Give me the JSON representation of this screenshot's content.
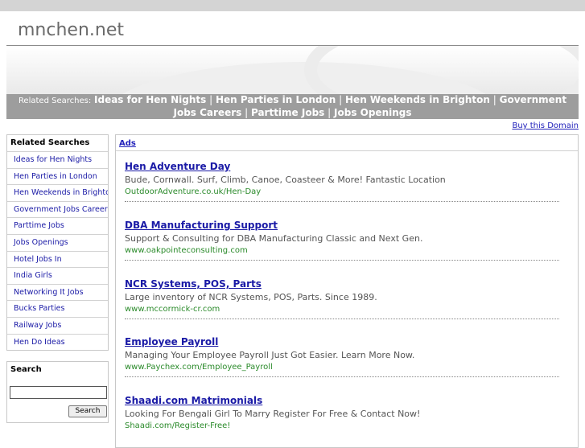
{
  "header": {
    "domain": "mnchen.net"
  },
  "related_bar": {
    "label": "Related Searches:",
    "links": [
      "Ideas for Hen Nights",
      "Hen Parties in London",
      "Hen Weekends in Brighton",
      "Government Jobs Careers",
      "Parttime Jobs",
      "Jobs Openings"
    ],
    "separator": "|"
  },
  "buy_link": "Buy this Domain",
  "sidebar": {
    "title": "Related Searches",
    "items": [
      "Ideas for Hen Nights",
      "Hen Parties in London",
      "Hen Weekends in Brighton",
      "Government Jobs Careers",
      "Parttime Jobs",
      "Jobs Openings",
      "Hotel Jobs In",
      "India Girls",
      "Networking It Jobs",
      "Bucks Parties",
      "Railway Jobs",
      "Hen Do Ideas"
    ]
  },
  "search": {
    "title": "Search",
    "value": "",
    "button": "Search"
  },
  "ads": {
    "label": "Ads",
    "items": [
      {
        "title": "Hen Adventure Day",
        "desc": "Bude, Cornwall. Surf, Climb, Canoe, Coasteer & More! Fantastic Location",
        "url": "OutdoorAdventure.co.uk/Hen-Day"
      },
      {
        "title": "DBA Manufacturing Support",
        "desc": "Support & Consulting for DBA Manufacturing Classic and Next Gen.",
        "url": "www.oakpointeconsulting.com"
      },
      {
        "title": "NCR Systems, POS, Parts",
        "desc": "Large inventory of NCR Systems, POS, Parts. Since 1989.",
        "url": "www.mccormick-cr.com"
      },
      {
        "title": "Employee Payroll",
        "desc": "Managing Your Employee Payroll Just Got Easier. Learn More Now.",
        "url": "www.Paychex.com/Employee_Payroll"
      },
      {
        "title": "Shaadi.com Matrimonials",
        "desc": "Looking For Bengali Girl To Marry Register For Free & Contact Now!",
        "url": "Shaadi.com/Register-Free!"
      }
    ]
  }
}
